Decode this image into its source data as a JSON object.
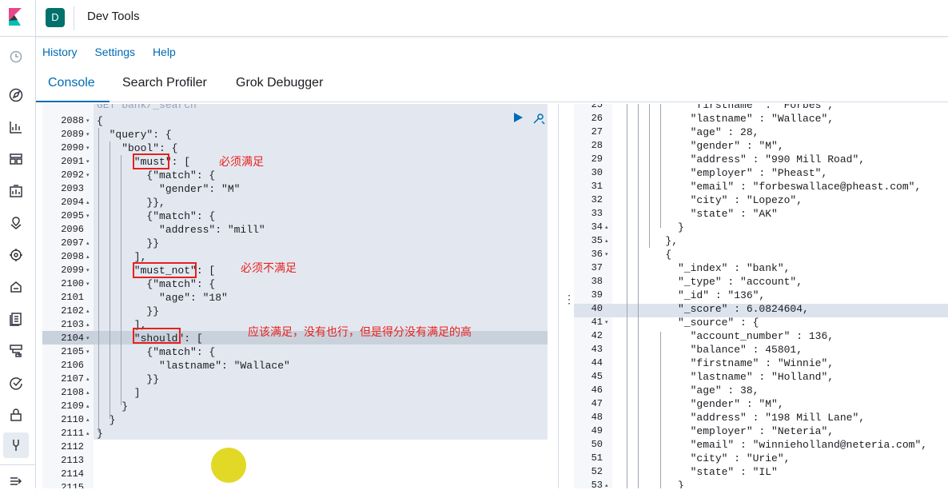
{
  "header": {
    "space_initial": "D",
    "title": "Dev Tools"
  },
  "menu": {
    "history": "History",
    "settings": "Settings",
    "help": "Help"
  },
  "tabs": {
    "console": "Console",
    "search_profiler": "Search Profiler",
    "grok_debugger": "Grok Debugger"
  },
  "editor": {
    "top_partial": "GET bank/_search",
    "lines": [
      {
        "n": "2088",
        "fold": "▾",
        "code": "{"
      },
      {
        "n": "2089",
        "fold": "▾",
        "code": "  \"query\": {"
      },
      {
        "n": "2090",
        "fold": "▾",
        "code": "    \"bool\": {"
      },
      {
        "n": "2091",
        "fold": "▾",
        "code": "      \"must\": ["
      },
      {
        "n": "2092",
        "fold": "▾",
        "code": "        {\"match\": {"
      },
      {
        "n": "2093",
        "fold": "",
        "code": "          \"gender\": \"M\""
      },
      {
        "n": "2094",
        "fold": "▴",
        "code": "        }},"
      },
      {
        "n": "2095",
        "fold": "▾",
        "code": "        {\"match\": {"
      },
      {
        "n": "2096",
        "fold": "",
        "code": "          \"address\": \"mill\""
      },
      {
        "n": "2097",
        "fold": "▴",
        "code": "        }}"
      },
      {
        "n": "2098",
        "fold": "▴",
        "code": "      ],"
      },
      {
        "n": "2099",
        "fold": "▾",
        "code": "      \"must_not\": ["
      },
      {
        "n": "2100",
        "fold": "▾",
        "code": "        {\"match\": {"
      },
      {
        "n": "2101",
        "fold": "",
        "code": "          \"age\": \"18\""
      },
      {
        "n": "2102",
        "fold": "▴",
        "code": "        }}"
      },
      {
        "n": "2103",
        "fold": "▴",
        "code": "      ],"
      },
      {
        "n": "2104",
        "fold": "▾",
        "code": "      \"should\": ["
      },
      {
        "n": "2105",
        "fold": "▾",
        "code": "        {\"match\": {"
      },
      {
        "n": "2106",
        "fold": "",
        "code": "          \"lastname\": \"Wallace\""
      },
      {
        "n": "2107",
        "fold": "▴",
        "code": "        }}"
      },
      {
        "n": "2108",
        "fold": "▴",
        "code": "      ]"
      },
      {
        "n": "2109",
        "fold": "▴",
        "code": "    }"
      },
      {
        "n": "2110",
        "fold": "▴",
        "code": "  }"
      },
      {
        "n": "2111",
        "fold": "▴",
        "code": "}"
      },
      {
        "n": "2112",
        "fold": "",
        "code": ""
      },
      {
        "n": "2113",
        "fold": "",
        "code": ""
      },
      {
        "n": "2114",
        "fold": "",
        "code": ""
      },
      {
        "n": "2115",
        "fold": "",
        "code": ""
      }
    ],
    "annotations": {
      "must": "必须满足",
      "must_not": "必须不满足",
      "should": "应该满足，没有也行，但是得分没有满足的高"
    }
  },
  "output": {
    "lines": [
      {
        "n": "25",
        "fold": "",
        "code": "            \"firstname\" : \"Forbes\","
      },
      {
        "n": "26",
        "fold": "",
        "code": "            \"lastname\" : \"Wallace\","
      },
      {
        "n": "27",
        "fold": "",
        "code": "            \"age\" : 28,"
      },
      {
        "n": "28",
        "fold": "",
        "code": "            \"gender\" : \"M\","
      },
      {
        "n": "29",
        "fold": "",
        "code": "            \"address\" : \"990 Mill Road\","
      },
      {
        "n": "30",
        "fold": "",
        "code": "            \"employer\" : \"Pheast\","
      },
      {
        "n": "31",
        "fold": "",
        "code": "            \"email\" : \"forbeswallace@pheast.com\","
      },
      {
        "n": "32",
        "fold": "",
        "code": "            \"city\" : \"Lopezo\","
      },
      {
        "n": "33",
        "fold": "",
        "code": "            \"state\" : \"AK\""
      },
      {
        "n": "34",
        "fold": "▴",
        "code": "          }"
      },
      {
        "n": "35",
        "fold": "▴",
        "code": "        },"
      },
      {
        "n": "36",
        "fold": "▾",
        "code": "        {"
      },
      {
        "n": "37",
        "fold": "",
        "code": "          \"_index\" : \"bank\","
      },
      {
        "n": "38",
        "fold": "",
        "code": "          \"_type\" : \"account\","
      },
      {
        "n": "39",
        "fold": "",
        "code": "          \"_id\" : \"136\","
      },
      {
        "n": "40",
        "fold": "",
        "code": "          \"_score\" : 6.0824604,"
      },
      {
        "n": "41",
        "fold": "▾",
        "code": "          \"_source\" : {"
      },
      {
        "n": "42",
        "fold": "",
        "code": "            \"account_number\" : 136,"
      },
      {
        "n": "43",
        "fold": "",
        "code": "            \"balance\" : 45801,"
      },
      {
        "n": "44",
        "fold": "",
        "code": "            \"firstname\" : \"Winnie\","
      },
      {
        "n": "45",
        "fold": "",
        "code": "            \"lastname\" : \"Holland\","
      },
      {
        "n": "46",
        "fold": "",
        "code": "            \"age\" : 38,"
      },
      {
        "n": "47",
        "fold": "",
        "code": "            \"gender\" : \"M\","
      },
      {
        "n": "48",
        "fold": "",
        "code": "            \"address\" : \"198 Mill Lane\","
      },
      {
        "n": "49",
        "fold": "",
        "code": "            \"employer\" : \"Neteria\","
      },
      {
        "n": "50",
        "fold": "",
        "code": "            \"email\" : \"winnieholland@neteria.com\","
      },
      {
        "n": "51",
        "fold": "",
        "code": "            \"city\" : \"Urie\","
      },
      {
        "n": "52",
        "fold": "",
        "code": "            \"state\" : \"IL\""
      },
      {
        "n": "53",
        "fold": "▴",
        "code": "          }"
      }
    ]
  }
}
